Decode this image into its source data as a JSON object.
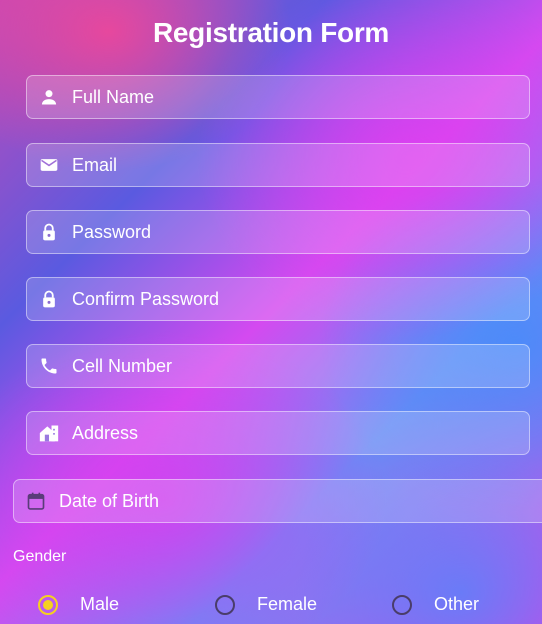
{
  "form": {
    "title": "Registration Form",
    "fields": [
      {
        "label": "Full Name",
        "icon": "person-icon"
      },
      {
        "label": "Email",
        "icon": "mail-icon"
      },
      {
        "label": "Password",
        "icon": "lock-icon"
      },
      {
        "label": "Confirm Password",
        "icon": "lock-icon"
      },
      {
        "label": "Cell Number",
        "icon": "phone-icon"
      },
      {
        "label": "Address",
        "icon": "home-icon"
      },
      {
        "label": "Date of Birth",
        "icon": "calendar-icon"
      }
    ],
    "gender": {
      "label": "Gender",
      "options": [
        {
          "label": "Male",
          "selected": true
        },
        {
          "label": "Female",
          "selected": false
        },
        {
          "label": "Other",
          "selected": false
        }
      ]
    }
  },
  "colors": {
    "radio_selected": "#f5d020",
    "radio_unselected": "#4a3d6a"
  }
}
